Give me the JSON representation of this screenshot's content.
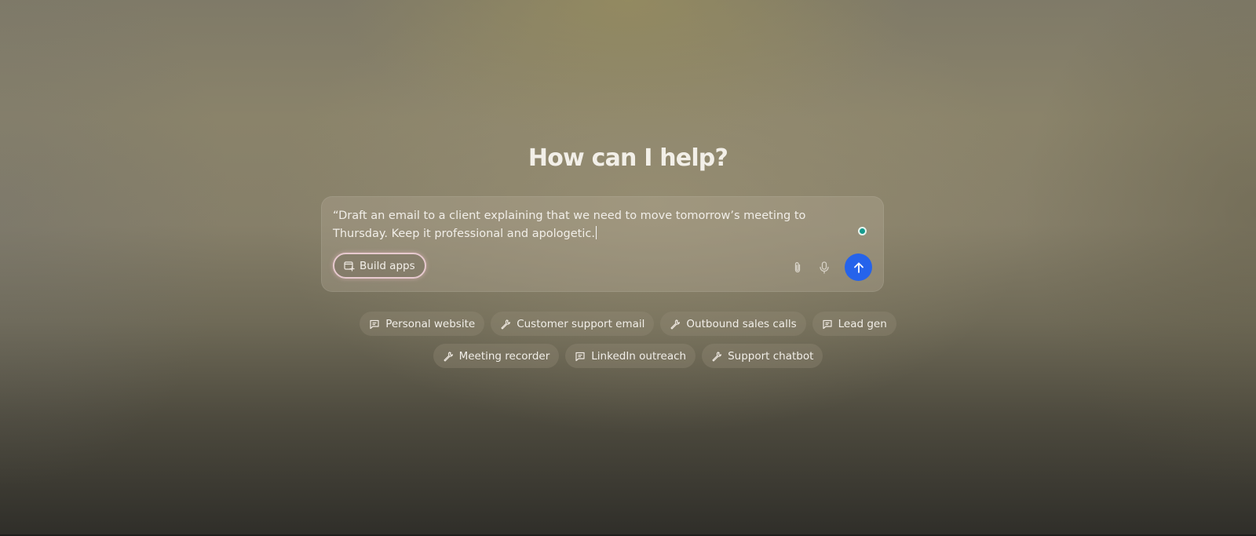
{
  "main": {
    "title": "How can I help?"
  },
  "prompt": {
    "text": "“Draft an email to a client explaining that we need to move tomorrow’s meeting to Thursday. Keep it professional and apologetic.",
    "build_button_label": "Build apps",
    "build_button_icon": "app-builder-icon",
    "attach_icon": "paperclip-icon",
    "mic_icon": "microphone-icon",
    "send_icon": "arrow-up-icon",
    "send_color": "#2563eb",
    "grammar_indicator_color": "#169b8e"
  },
  "suggestions": {
    "row1": [
      {
        "label": "Personal website",
        "icon": "chat-icon"
      },
      {
        "label": "Customer support email",
        "icon": "wrench-icon"
      },
      {
        "label": "Outbound sales calls",
        "icon": "wrench-icon"
      },
      {
        "label": "Lead gen",
        "icon": "chat-icon"
      }
    ],
    "row2": [
      {
        "label": "Meeting recorder",
        "icon": "wrench-icon"
      },
      {
        "label": "LinkedIn outreach",
        "icon": "chat-icon"
      },
      {
        "label": "Support chatbot",
        "icon": "wrench-icon"
      }
    ]
  }
}
